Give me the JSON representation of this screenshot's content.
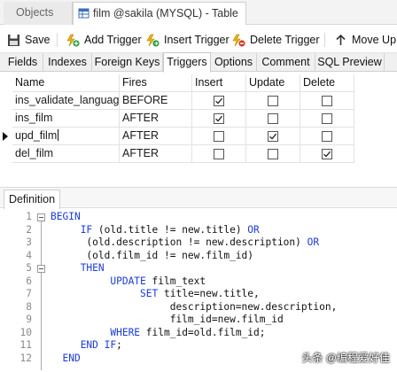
{
  "window_tabs": {
    "objects": "Objects",
    "active": "film @sakila (MYSQL) - Table"
  },
  "toolbar": {
    "save": "Save",
    "add_trigger": "Add Trigger",
    "insert_trigger": "Insert Trigger",
    "delete_trigger": "Delete Trigger",
    "move_up": "Move Up"
  },
  "subtabs": [
    "Fields",
    "Indexes",
    "Foreign Keys",
    "Triggers",
    "Options",
    "Comment",
    "SQL Preview"
  ],
  "active_subtab": "Triggers",
  "grid": {
    "headers": [
      "Name",
      "Fires",
      "Insert",
      "Update",
      "Delete"
    ],
    "rows": [
      {
        "name": "ins_validate_language",
        "fires": "BEFORE",
        "insert": true,
        "update": false,
        "delete": false
      },
      {
        "name": "ins_film",
        "fires": "AFTER",
        "insert": true,
        "update": false,
        "delete": false
      },
      {
        "name": "upd_film",
        "fires": "AFTER",
        "insert": false,
        "update": true,
        "delete": false
      },
      {
        "name": "del_film",
        "fires": "AFTER",
        "insert": false,
        "update": false,
        "delete": true
      }
    ]
  },
  "definition": {
    "tab": "Definition",
    "lines": [
      {
        "n": "1",
        "fold": true,
        "parts": [
          {
            "k": true,
            "t": "BEGIN"
          }
        ]
      },
      {
        "n": "2",
        "fold": false,
        "parts": [
          {
            "k": false,
            "t": "     "
          },
          {
            "k": true,
            "t": "IF"
          },
          {
            "k": false,
            "t": " (old.title != new.title) "
          },
          {
            "k": true,
            "t": "OR"
          }
        ]
      },
      {
        "n": "3",
        "fold": false,
        "parts": [
          {
            "k": false,
            "t": "      (old.description != new.description) "
          },
          {
            "k": true,
            "t": "OR"
          }
        ]
      },
      {
        "n": "4",
        "fold": false,
        "parts": [
          {
            "k": false,
            "t": "      (old.film_id != new.film_id)"
          }
        ]
      },
      {
        "n": "5",
        "fold": true,
        "parts": [
          {
            "k": false,
            "t": "     "
          },
          {
            "k": true,
            "t": "THEN"
          }
        ]
      },
      {
        "n": "6",
        "fold": false,
        "parts": [
          {
            "k": false,
            "t": "          "
          },
          {
            "k": true,
            "t": "UPDATE"
          },
          {
            "k": false,
            "t": " film_text"
          }
        ]
      },
      {
        "n": "7",
        "fold": false,
        "parts": [
          {
            "k": false,
            "t": "               "
          },
          {
            "k": true,
            "t": "SET"
          },
          {
            "k": false,
            "t": " title=new.title,"
          }
        ]
      },
      {
        "n": "8",
        "fold": false,
        "parts": [
          {
            "k": false,
            "t": "                    description=new.description,"
          }
        ]
      },
      {
        "n": "9",
        "fold": false,
        "parts": [
          {
            "k": false,
            "t": "                    film_id=new.film_id"
          }
        ]
      },
      {
        "n": "10",
        "fold": false,
        "parts": [
          {
            "k": false,
            "t": "          "
          },
          {
            "k": true,
            "t": "WHERE"
          },
          {
            "k": false,
            "t": " film_id=old.film_id;"
          }
        ]
      },
      {
        "n": "11",
        "fold": false,
        "parts": [
          {
            "k": false,
            "t": "     "
          },
          {
            "k": true,
            "t": "END IF"
          },
          {
            "k": false,
            "t": ";"
          }
        ]
      },
      {
        "n": "12",
        "fold": false,
        "parts": [
          {
            "k": false,
            "t": "  "
          },
          {
            "k": true,
            "t": "END"
          }
        ]
      }
    ]
  },
  "watermark": "头条 @编程爱好佳",
  "colors": {
    "keyword": "#1c3bd8",
    "text": "#111111",
    "line_number": "#8a8a8a"
  }
}
